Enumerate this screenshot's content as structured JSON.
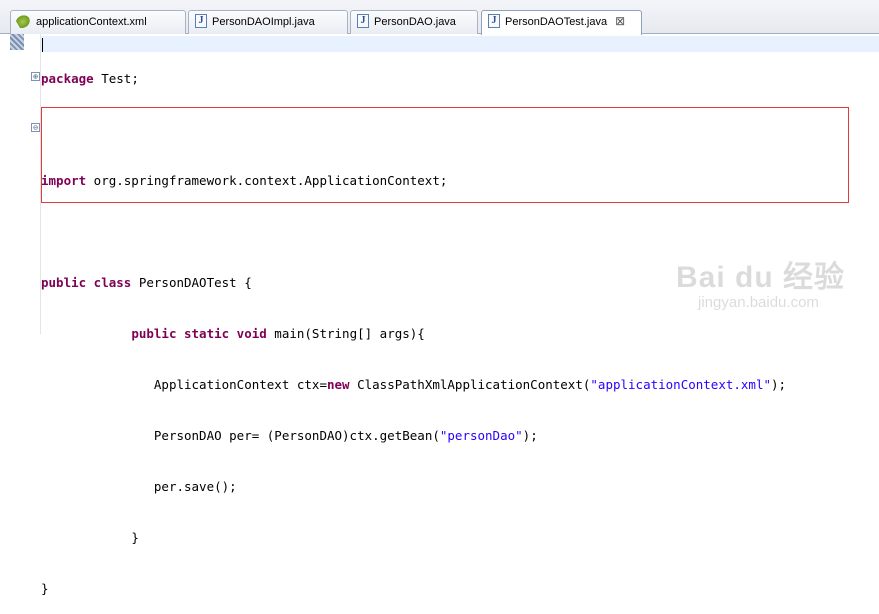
{
  "tabs": [
    {
      "label": "applicationContext.xml",
      "icon": "xml-file-icon",
      "active": false
    },
    {
      "label": "PersonDAOImpl.java",
      "icon": "java-file-icon",
      "active": false
    },
    {
      "label": "PersonDAO.java",
      "icon": "java-file-icon",
      "active": false
    },
    {
      "label": "PersonDAOTest.java",
      "icon": "java-file-icon",
      "active": true,
      "close_glyph": "⊠"
    }
  ],
  "editor": {
    "lines": [
      {
        "kw": "package",
        "rest": " Test;"
      },
      {
        "text": ""
      },
      {
        "kw": "import",
        "rest": " org.springframework.context.ApplicationContext;"
      },
      {
        "text": ""
      },
      {
        "kw": "public class",
        "rest": " PersonDAOTest {"
      },
      {
        "indent": "            ",
        "kw": "public static void",
        "rest": " main(String[] args){"
      },
      {
        "indent": "               ",
        "pre": "ApplicationContext ctx=",
        "kw": "new",
        "mid": " ClassPathXmlApplicationContext(",
        "str": "\"applicationContext.xml\"",
        "post": ");"
      },
      {
        "indent": "               ",
        "pre": "PersonDAO per= (PersonDAO)ctx.getBean(",
        "str": "\"personDao\"",
        "post": ");"
      },
      {
        "indent": "               ",
        "pre": "per.save();"
      },
      {
        "indent": "            ",
        "pre": "}"
      },
      {
        "pre": "}"
      }
    ],
    "fold_markers": [
      "⊕",
      "⊖"
    ]
  },
  "watermark": {
    "brand": "Bai du 经验",
    "url": "jingyan.baidu.com"
  },
  "colors": {
    "keyword": "#7f0055",
    "string": "#2a00ff",
    "highlight_box": "#e03b3b",
    "current_line": "#e8f2fe"
  }
}
